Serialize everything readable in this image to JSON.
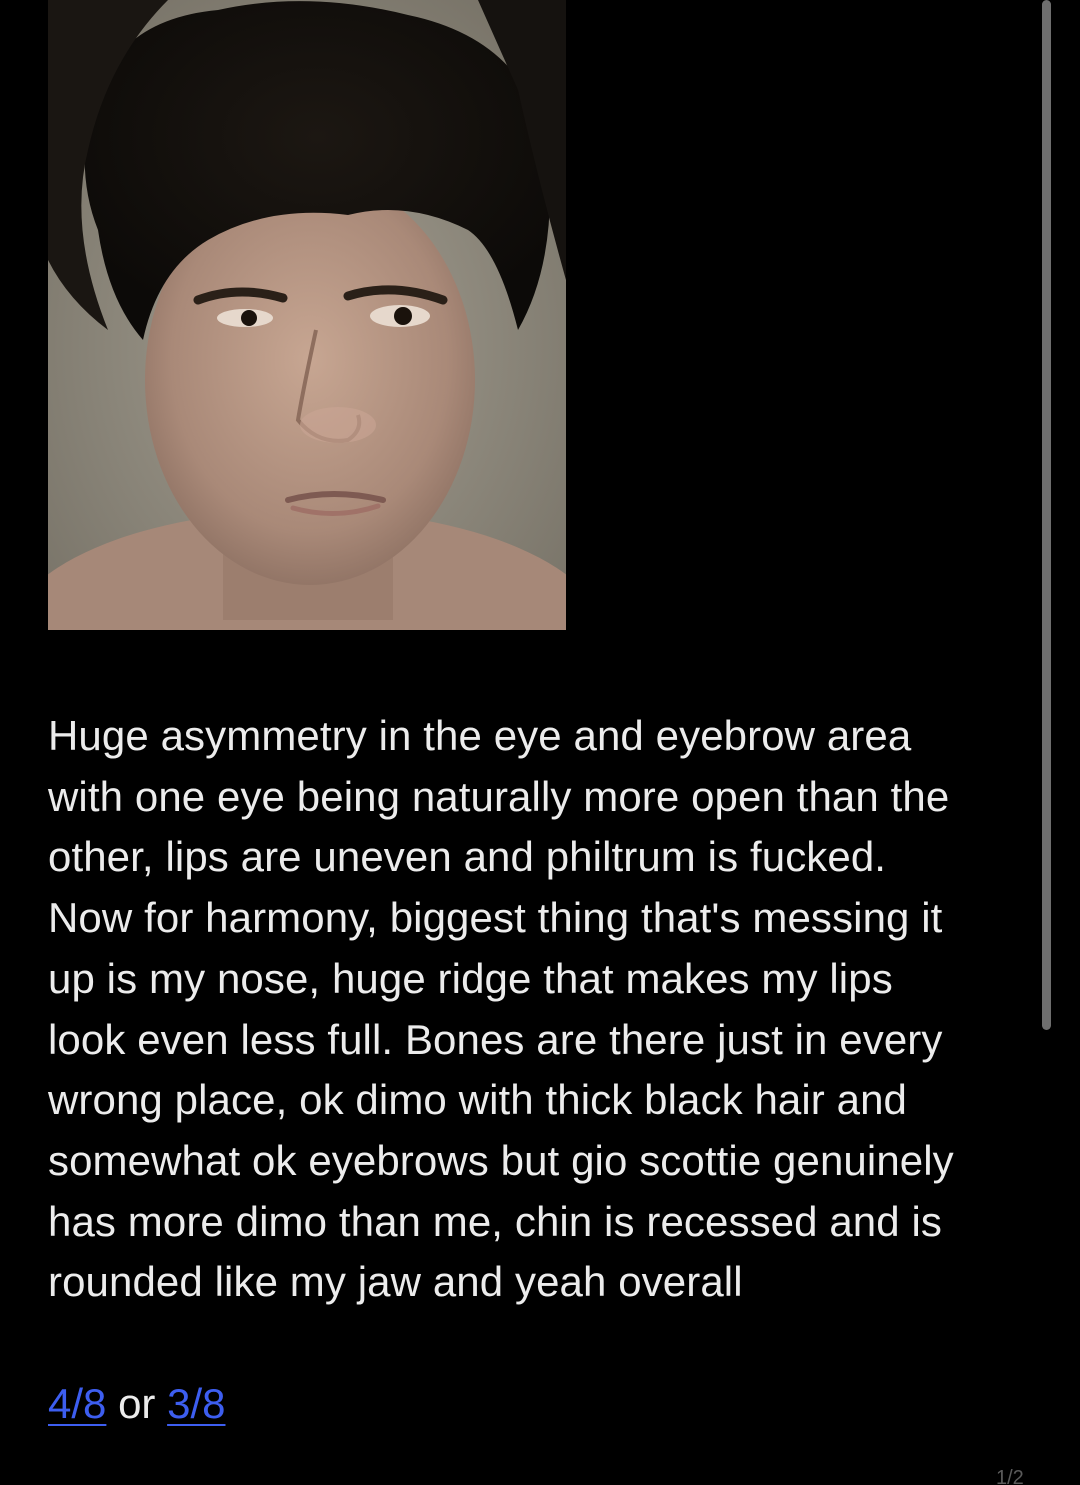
{
  "post": {
    "photo_alt": "selfie photo",
    "body_lines": [
      "Huge asymmetry in the eye and eyebrow area",
      "with one eye being naturally more open than the",
      "other, lips are uneven and philtrum is fucked.",
      "Now for harmony, biggest thing that's messing it",
      "up is my nose, huge ridge that makes my lips",
      "look even less full. Bones are there just in every",
      "wrong place, ok dimo with thick black hair and",
      "somewhat ok eyebrows but gio scottie genuinely",
      "has more dimo than me, chin is recessed and is",
      "rounded like my jaw and yeah overall"
    ],
    "rating": {
      "first_link": "4/8",
      "separator": "or",
      "second_link": "3/8"
    }
  },
  "page_indicator": "1/2",
  "colors": {
    "background": "#000000",
    "text": "#ececec",
    "link": "#3d5ef0",
    "scrollbar": "#6e6e6e"
  }
}
